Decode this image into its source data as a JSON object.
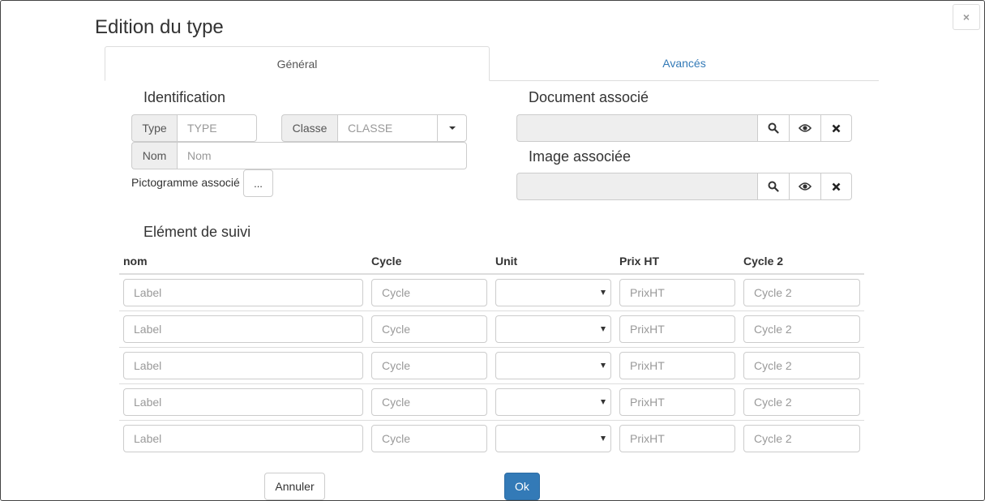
{
  "dialog": {
    "title": "Edition du type",
    "close_glyph": "×"
  },
  "tabs": [
    {
      "label": "Général",
      "active": true
    },
    {
      "label": "Avancés",
      "active": false
    }
  ],
  "identification": {
    "heading": "Identification",
    "type_label": "Type",
    "type_placeholder": "TYPE",
    "classe_label": "Classe",
    "classe_placeholder": "CLASSE",
    "nom_label": "Nom",
    "nom_placeholder": "Nom",
    "picto_label": "Pictogramme associé",
    "picto_button": "..."
  },
  "document": {
    "heading": "Document associé",
    "value": ""
  },
  "image": {
    "heading": "Image associée",
    "value": ""
  },
  "suivi": {
    "heading": "Elément de suivi",
    "columns": [
      "nom",
      "Cycle",
      "Unit",
      "Prix HT",
      "Cycle 2"
    ],
    "row_placeholders": {
      "label": "Label",
      "cycle": "Cycle",
      "unit": "",
      "prix": "PrixHT",
      "cycle2": "Cycle 2"
    },
    "row_count": 5
  },
  "footer": {
    "cancel_label": "Annuler",
    "ok_label": "Ok"
  },
  "colors": {
    "primary": "#337ab7",
    "tab_link": "#337ab7",
    "addon_bg": "#eeeeee",
    "border": "#cccccc"
  },
  "icons": {
    "search": "search-icon",
    "view": "eye-icon",
    "remove": "times-icon",
    "close": "close-icon",
    "dropdown": "caret-down-icon"
  }
}
